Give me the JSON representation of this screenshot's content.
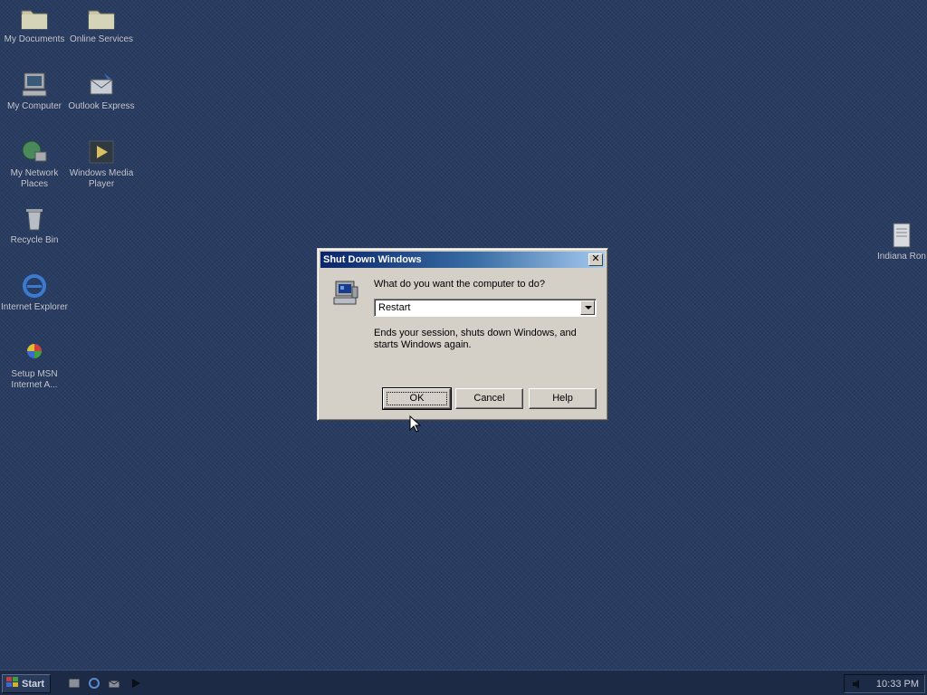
{
  "desktop": {
    "icons": [
      {
        "label": "My Documents",
        "icon": "folder-icon"
      },
      {
        "label": "Online Services",
        "icon": "folder-icon"
      },
      {
        "label": "My Computer",
        "icon": "computer-icon"
      },
      {
        "label": "Outlook Express",
        "icon": "mail-icon"
      },
      {
        "label": "My Network Places",
        "icon": "network-icon"
      },
      {
        "label": "Windows Media Player",
        "icon": "media-player-icon"
      },
      {
        "label": "Recycle Bin",
        "icon": "recycle-bin-icon"
      },
      {
        "label": "Internet Explorer",
        "icon": "internet-explorer-icon"
      },
      {
        "label": "Setup MSN Internet A...",
        "icon": "msn-icon"
      },
      {
        "label": "Indiana Ron",
        "icon": "document-icon"
      }
    ]
  },
  "dialog": {
    "title": "Shut Down Windows",
    "close_glyph": "✕",
    "question": "What do you want the computer to do?",
    "selected_option": "Restart",
    "description": "Ends your session, shuts down Windows, and starts Windows again.",
    "buttons": {
      "ok": "OK",
      "cancel": "Cancel",
      "help": "Help"
    }
  },
  "taskbar": {
    "start_label": "Start",
    "clock": "10:33 PM"
  },
  "colors": {
    "desktop": "#283c61",
    "title_active_start": "#0a246a",
    "title_active_end": "#a6caf0",
    "dialog_face": "#d4d0c8"
  }
}
